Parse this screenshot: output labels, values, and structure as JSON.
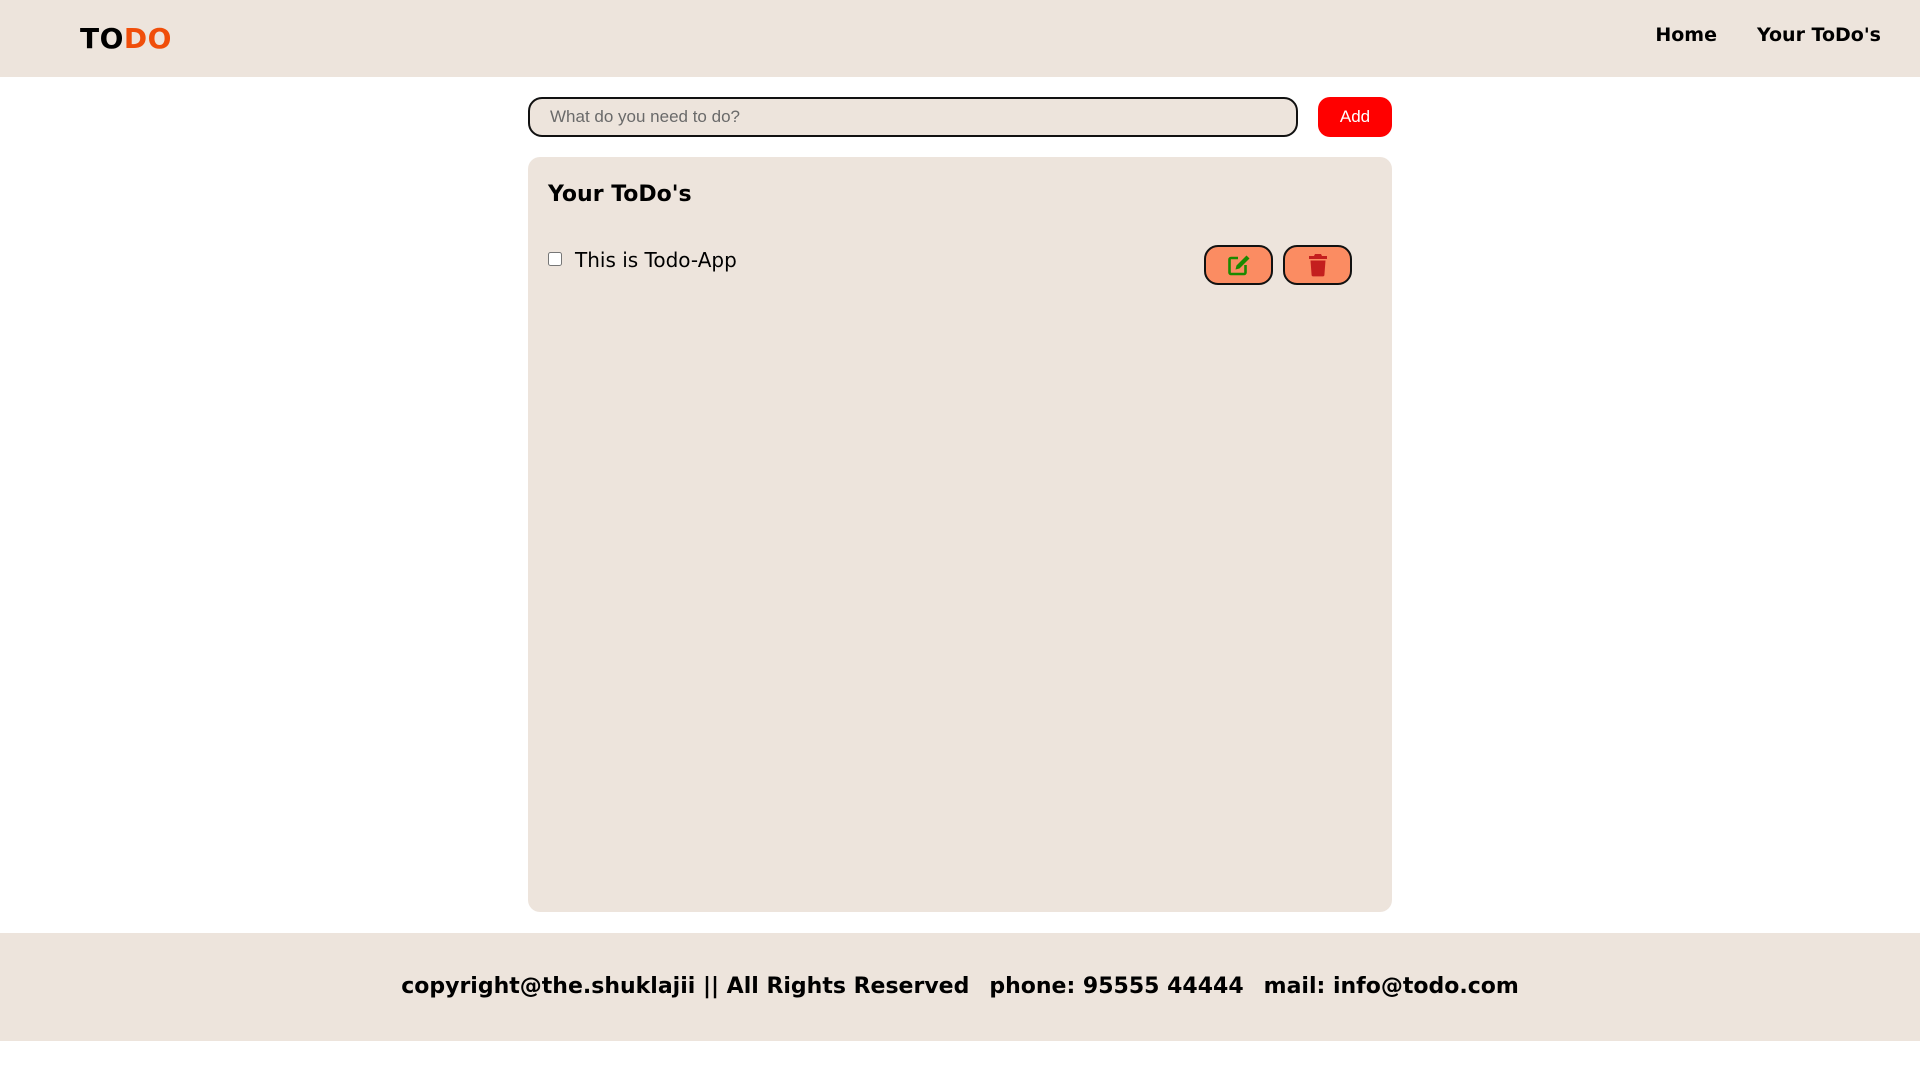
{
  "header": {
    "logo_part1": "TO",
    "logo_part2": "DO",
    "nav": [
      {
        "label": "Home"
      },
      {
        "label": "Your ToDo's"
      }
    ]
  },
  "add_bar": {
    "placeholder": "What do you need to do?",
    "value": "",
    "add_label": "Add"
  },
  "todo_list": {
    "title": "Your ToDo's",
    "items": [
      {
        "text": "This is Todo-App",
        "checked": false
      }
    ],
    "edit_icon": "edit-icon",
    "delete_icon": "trash-icon"
  },
  "footer": {
    "copyright": "copyright@the.shuklajii || All Rights Reserved",
    "phone": "phone: 95555 44444",
    "mail": "mail: info@todo.com"
  },
  "colors": {
    "background_beige": "#ede4dc",
    "logo_accent": "#f04e0a",
    "add_button": "#ff0000",
    "action_button": "#fb8c62",
    "edit_icon": "#1a8a00",
    "delete_icon": "#c41e1e"
  }
}
